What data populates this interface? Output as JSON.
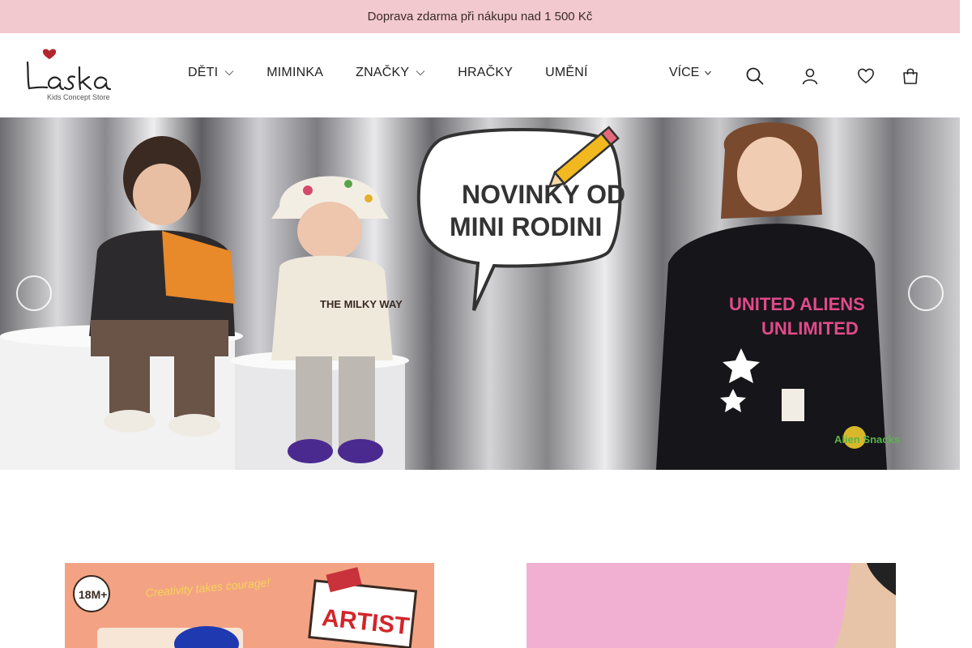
{
  "promo": {
    "text": "Doprava zdarma při nákupu nad 1 500 Kč",
    "left_glyph": "",
    "right_glyph": "",
    "close_glyph": ""
  },
  "header": {
    "logo_text": "Láska",
    "logo_subtitle": "Kids Concept Store",
    "nav": [
      {
        "label": "DĚTI",
        "has_dropdown": true
      },
      {
        "label": "MIMINKA",
        "has_dropdown": false
      },
      {
        "label": "ZNAČKY",
        "has_dropdown": true
      },
      {
        "label": "HRAČKY",
        "has_dropdown": false
      },
      {
        "label": "UMĚNÍ",
        "has_dropdown": false
      }
    ],
    "more_label": "VÍCE",
    "icons": [
      "search-icon",
      "user-icon",
      "heart-icon",
      "cart-icon"
    ]
  },
  "hero": {
    "bubble_line1": "NOVINKY OD",
    "bubble_line2": "MINI RODINI",
    "jacket_line1": "UNITED ALIENS",
    "jacket_line2": "UNLIMITED",
    "sweater_text": "THE MILKY WAY",
    "patch_text": "Alien Snacks",
    "prev_glyph": "",
    "next_glyph": ""
  },
  "cards": {
    "left": {
      "badge": "18M+",
      "tagline": "Creativity takes courage!",
      "sign": "ARTIST"
    }
  },
  "colors": {
    "promo_bg": "#f2c9ce",
    "accent_red": "#b3262e",
    "card_left_bg": "#f3a383",
    "card_right_bg": "#f1b0d2"
  }
}
